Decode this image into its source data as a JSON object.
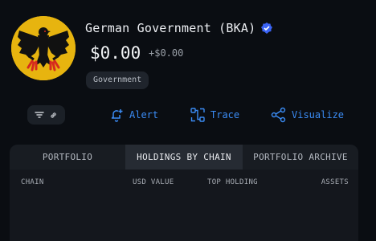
{
  "entity": {
    "name": "German Government (BKA)",
    "balance": "$0.00",
    "change": "+$0.00",
    "tag": "Government"
  },
  "actions": {
    "alert": "Alert",
    "trace": "Trace",
    "visualize": "Visualize"
  },
  "tabs": [
    "PORTFOLIO",
    "HOLDINGS BY CHAIN",
    "PORTFOLIO ARCHIVE"
  ],
  "columns": {
    "chain": "CHAIN",
    "usd_value": "USD VALUE",
    "top_holding": "TOP HOLDING",
    "assets": "ASSETS"
  },
  "colors": {
    "accent": "#3b8cf5",
    "avatar_gold": "#e7b40f",
    "eagle": "#111111",
    "eagle_red": "#d62a1e"
  },
  "icons": [
    "eagle-emblem",
    "verified-badge-icon",
    "filter-icon",
    "link-icon",
    "bell-plus-icon",
    "trace-icon",
    "graph-icon"
  ]
}
